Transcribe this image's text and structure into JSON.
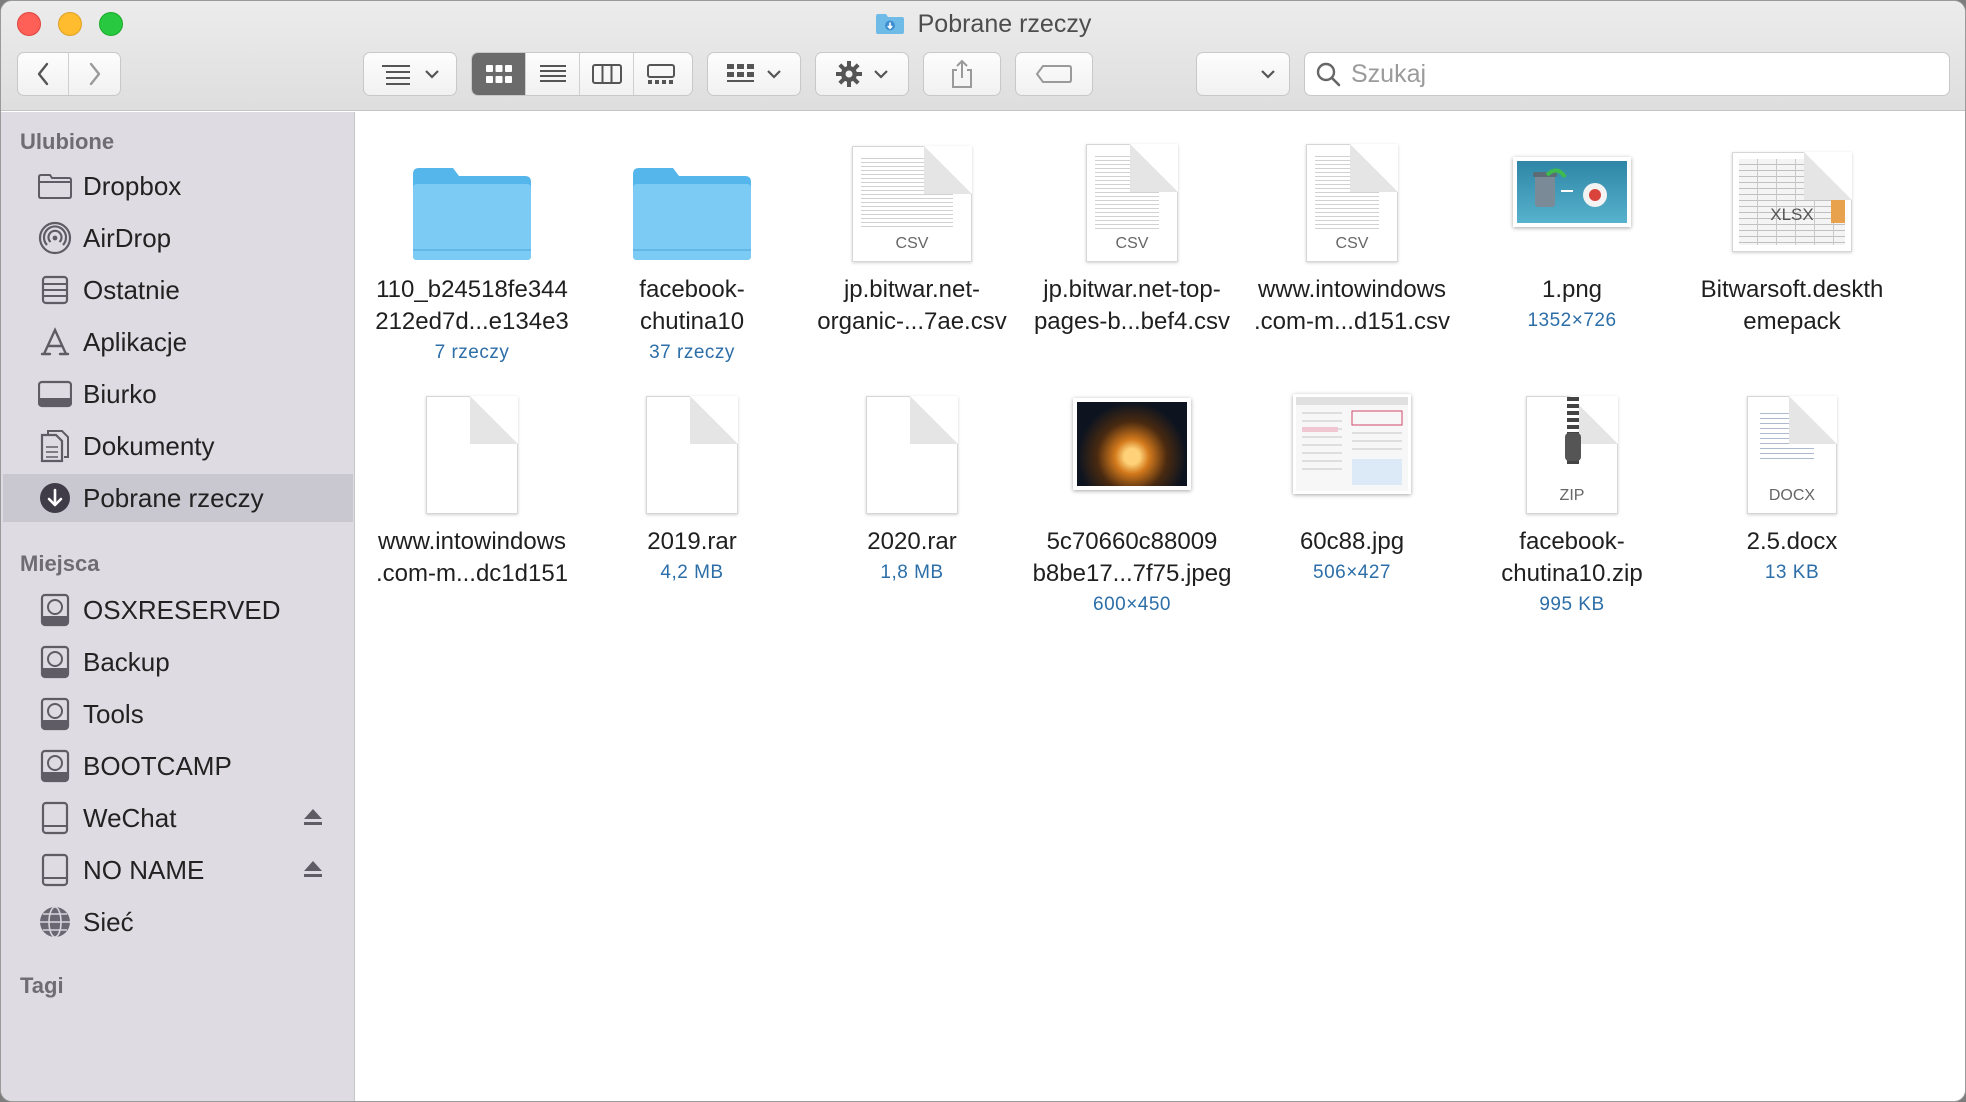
{
  "window": {
    "title": "Pobrane rzeczy"
  },
  "toolbar": {
    "view_modes": [
      "icon-view-icon",
      "list-view-icon",
      "column-view-icon",
      "gallery-view-icon"
    ],
    "active_view": 0
  },
  "search": {
    "placeholder": "Szukaj",
    "value": ""
  },
  "sidebar": {
    "favorites_header": "Ulubione",
    "favorites": [
      {
        "label": "Dropbox",
        "icon": "folder-icon"
      },
      {
        "label": "AirDrop",
        "icon": "airdrop-icon"
      },
      {
        "label": "Ostatnie",
        "icon": "recents-icon"
      },
      {
        "label": "Aplikacje",
        "icon": "applications-icon"
      },
      {
        "label": "Biurko",
        "icon": "desktop-icon"
      },
      {
        "label": "Dokumenty",
        "icon": "documents-icon"
      },
      {
        "label": "Pobrane rzeczy",
        "icon": "downloads-icon",
        "selected": true
      }
    ],
    "locations_header": "Miejsca",
    "locations": [
      {
        "label": "OSXRESERVED",
        "icon": "disk-icon"
      },
      {
        "label": "Backup",
        "icon": "disk-icon"
      },
      {
        "label": "Tools",
        "icon": "disk-icon"
      },
      {
        "label": "BOOTCAMP",
        "icon": "disk-icon"
      },
      {
        "label": "WeChat",
        "icon": "external-drive-icon",
        "eject": true
      },
      {
        "label": "NO NAME",
        "icon": "external-drive-icon",
        "eject": true
      },
      {
        "label": "Sieć",
        "icon": "network-icon"
      }
    ],
    "tags_header": "Tagi"
  },
  "files": [
    {
      "name_line1": "110_b24518fe344",
      "name_line2": "212ed7d...e134e3",
      "meta": "7 rzeczy",
      "kind": "folder"
    },
    {
      "name_line1": "facebook-",
      "name_line2": "chutina10",
      "meta": "37 rzeczy",
      "kind": "folder"
    },
    {
      "name_line1": "jp.bitwar.net-",
      "name_line2": "organic-...7ae.csv",
      "meta": "",
      "kind": "csv",
      "tag": "CSV"
    },
    {
      "name_line1": "jp.bitwar.net-top-",
      "name_line2": "pages-b...bef4.csv",
      "meta": "",
      "kind": "csv",
      "tag": "CSV"
    },
    {
      "name_line1": "www.intowindows",
      "name_line2": ".com-m...d151.csv",
      "meta": "",
      "kind": "csv",
      "tag": "CSV"
    },
    {
      "name_line1": "1.png",
      "name_line2": "",
      "meta": "1352×726",
      "kind": "png"
    },
    {
      "name_line1": "Bitwarsoft.deskth",
      "name_line2": "emepack",
      "meta": "",
      "kind": "xlsx",
      "tag": "XLSX"
    },
    {
      "name_line1": "www.intowindows",
      "name_line2": ".com-m...dc1d151",
      "meta": "",
      "kind": "blank"
    },
    {
      "name_line1": "2019.rar",
      "name_line2": "",
      "meta": "4,2 MB",
      "kind": "blank"
    },
    {
      "name_line1": "2020.rar",
      "name_line2": "",
      "meta": "1,8 MB",
      "kind": "blank"
    },
    {
      "name_line1": "5c70660c88009",
      "name_line2": "b8be17...7f75.jpeg",
      "meta": "600×450",
      "kind": "photo"
    },
    {
      "name_line1": "60c88.jpg",
      "name_line2": "",
      "meta": "506×427",
      "kind": "screenshot"
    },
    {
      "name_line1": "facebook-",
      "name_line2": "chutina10.zip",
      "meta": "995 KB",
      "kind": "zip",
      "tag": "ZIP"
    },
    {
      "name_line1": "2.5.docx",
      "name_line2": "",
      "meta": "13 KB",
      "kind": "docx",
      "tag": "DOCX"
    }
  ]
}
